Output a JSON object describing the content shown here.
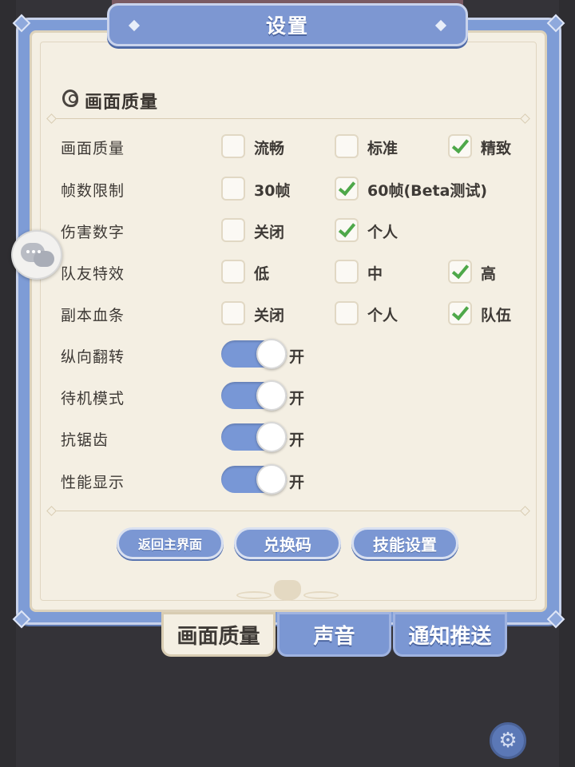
{
  "dialog": {
    "title": "设置"
  },
  "section": {
    "title": "画面质量"
  },
  "rows": [
    {
      "label": "画面质量",
      "options": [
        {
          "label": "流畅",
          "checked": false
        },
        {
          "label": "标准",
          "checked": false
        },
        {
          "label": "精致",
          "checked": true
        }
      ]
    },
    {
      "label": "帧数限制",
      "options": [
        {
          "label": "30帧",
          "checked": false
        },
        {
          "label": "60帧(Beta测试)",
          "checked": true
        }
      ]
    },
    {
      "label": "伤害数字",
      "options": [
        {
          "label": "关闭",
          "checked": false
        },
        {
          "label": "个人",
          "checked": true
        }
      ]
    },
    {
      "label": "队友特效",
      "options": [
        {
          "label": "低",
          "checked": false
        },
        {
          "label": "中",
          "checked": false
        },
        {
          "label": "高",
          "checked": true
        }
      ]
    },
    {
      "label": "副本血条",
      "options": [
        {
          "label": "关闭",
          "checked": false
        },
        {
          "label": "个人",
          "checked": false
        },
        {
          "label": "队伍",
          "checked": true
        }
      ]
    }
  ],
  "toggles": [
    {
      "label": "纵向翻转",
      "state": "开",
      "on": true
    },
    {
      "label": "待机模式",
      "state": "开",
      "on": true
    },
    {
      "label": "抗锯齿",
      "state": "开",
      "on": true
    },
    {
      "label": "性能显示",
      "state": "开",
      "on": true
    }
  ],
  "buttons": {
    "return_main": "返回主界面",
    "redeem_code": "兑换码",
    "skill_settings": "技能设置"
  },
  "tabs": [
    {
      "label": "画面质量",
      "active": true
    },
    {
      "label": "声音",
      "active": false
    },
    {
      "label": "通知推送",
      "active": false
    }
  ],
  "icons": {
    "section": "crystal-ball-icon",
    "chat": "chat-bubbles-icon",
    "gear": "gear-icon"
  },
  "colors": {
    "accent_blue": "#7b97d3",
    "paper": "#f4efe3",
    "check_green": "#4ea84a"
  }
}
